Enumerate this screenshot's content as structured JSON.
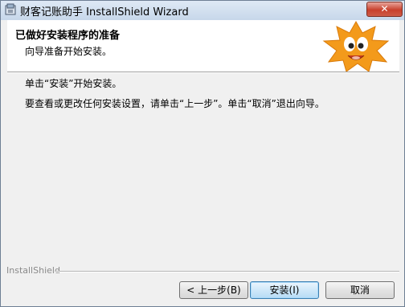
{
  "window": {
    "title": "财客记账助手 InstallShield Wizard",
    "close_label": "✕"
  },
  "header": {
    "title": "已做好安装程序的准备",
    "subtitle": "向导准备开始安装。"
  },
  "body": {
    "line1": "单击“安装”开始安装。",
    "line2": "要查看或更改任何安装设置，请单击“上一步”。单击“取消”退出向导。"
  },
  "footer": {
    "brand": "InstallShield"
  },
  "buttons": {
    "back": "< 上一步(B)",
    "install": "安装(I)",
    "cancel": "取消"
  },
  "colors": {
    "mascot_orange": "#f39a1b",
    "close_red": "#c8412d"
  }
}
